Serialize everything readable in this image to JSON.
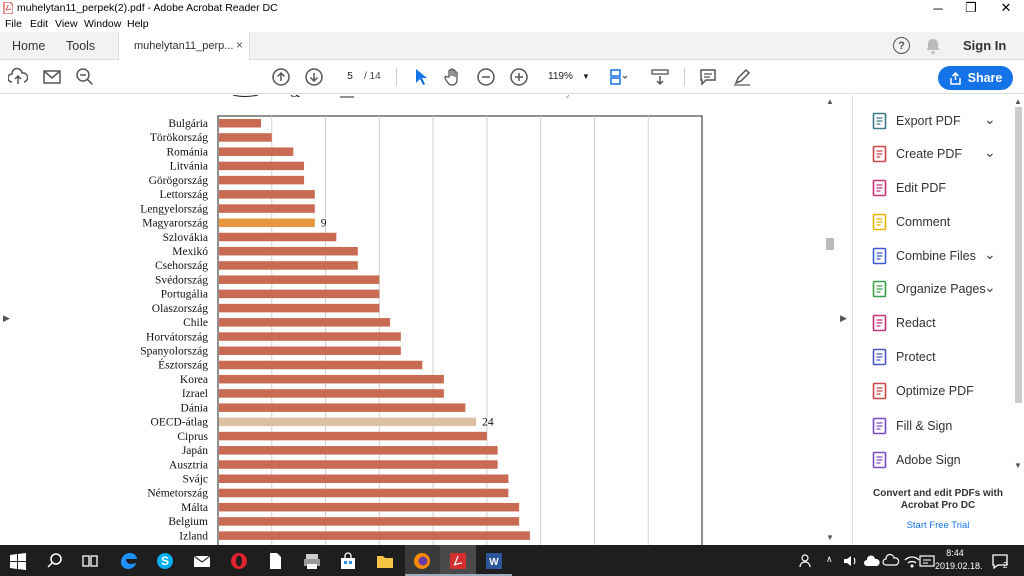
{
  "window": {
    "title": "muhelytan11_perpek(2).pdf - Adobe Acrobat Reader DC",
    "minimize": "─",
    "restore": "❐",
    "close": "✕"
  },
  "menu": [
    "File",
    "Edit",
    "View",
    "Window",
    "Help"
  ],
  "tabs": {
    "home": "Home",
    "tools": "Tools",
    "doc": "muhelytan11_perp...",
    "close": "×"
  },
  "header": {
    "help": "?",
    "signin": "Sign In"
  },
  "toolbar": {
    "page_current": "5",
    "page_total": "/ 14",
    "zoom": "119%",
    "share_label": "Share"
  },
  "right_panel": {
    "items": [
      {
        "label": "Export PDF",
        "icon": "export-pdf-icon",
        "color": "#3b7a8a",
        "chevron": true
      },
      {
        "label": "Create PDF",
        "icon": "create-pdf-icon",
        "color": "#d04545",
        "chevron": true
      },
      {
        "label": "Edit PDF",
        "icon": "edit-pdf-icon",
        "color": "#c7307a",
        "chevron": false
      },
      {
        "label": "Comment",
        "icon": "comment-icon",
        "color": "#e8b400",
        "chevron": false
      },
      {
        "label": "Combine Files",
        "icon": "combine-files-icon",
        "color": "#3f5bd8",
        "chevron": true
      },
      {
        "label": "Organize Pages",
        "icon": "organize-pages-icon",
        "color": "#3ba04a",
        "chevron": true
      },
      {
        "label": "Redact",
        "icon": "redact-icon",
        "color": "#c7307a",
        "chevron": false
      },
      {
        "label": "Protect",
        "icon": "protect-icon",
        "color": "#4a55c7",
        "chevron": false
      },
      {
        "label": "Optimize PDF",
        "icon": "optimize-pdf-icon",
        "color": "#d04545",
        "chevron": false
      },
      {
        "label": "Fill & Sign",
        "icon": "fill-sign-icon",
        "color": "#7a4ac7",
        "chevron": false
      },
      {
        "label": "Adobe Sign",
        "icon": "adobe-sign-icon",
        "color": "#7a4ac7",
        "chevron": false
      }
    ],
    "promo": "Convert and edit PDFs with Acrobat Pro DC",
    "trial": "Start Free Trial"
  },
  "taskbar": {
    "time": "8:44",
    "date": "2019.02.18.",
    "notifications": "2"
  },
  "chart_data": {
    "type": "bar",
    "orientation": "horizontal",
    "categories": [
      "Bulgária",
      "Törökország",
      "Románia",
      "Litvánia",
      "Görögország",
      "Lettország",
      "Lengyelország",
      "Magyarország",
      "Szlovákia",
      "Mexikó",
      "Csehország",
      "Svédország",
      "Portugália",
      "Olaszország",
      "Chile",
      "Horvátország",
      "Spanyolország",
      "Észtország",
      "Korea",
      "Izrael",
      "Dánia",
      "OECD-átlag",
      "Ciprus",
      "Japán",
      "Ausztria",
      "Svájc",
      "Németország",
      "Málta",
      "Belgium",
      "Izland"
    ],
    "values": [
      4,
      5,
      7,
      8,
      8,
      9,
      9,
      9,
      11,
      13,
      13,
      15,
      15,
      15,
      16,
      17,
      17,
      19,
      21,
      21,
      23,
      24,
      25,
      26,
      26,
      27,
      27,
      28,
      28,
      29
    ],
    "data_labels": {
      "Magyarország": "9",
      "OECD-átlag": "24"
    },
    "xlim": [
      0,
      45
    ],
    "colors": {
      "default": "#c96a52",
      "highlight": "#e8963e",
      "average": "#dcc0a3"
    },
    "grid": true
  }
}
